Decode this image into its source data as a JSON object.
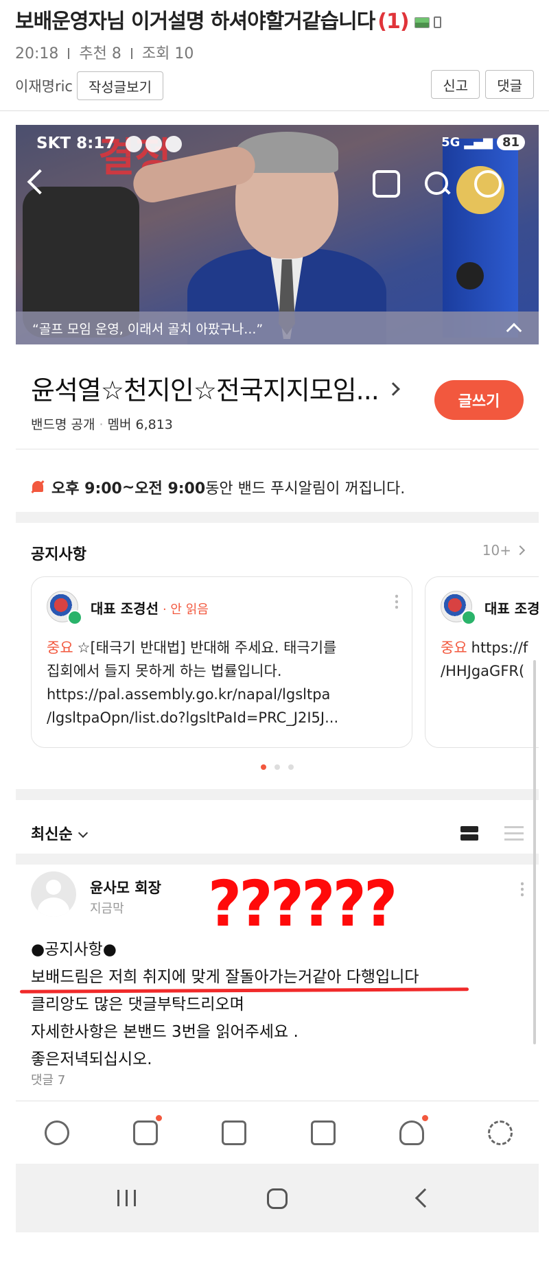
{
  "post": {
    "title": "보배운영자님 이거설명 하셔야할거같습니다",
    "comment_count_badge": "(1)",
    "title_icons": [
      "image-icon",
      "mobile-icon"
    ],
    "time": "20:18",
    "recommend": "추천 8",
    "views": "조회 10",
    "author": "이재명ric",
    "view_posts_button": "작성글보기",
    "report_button": "신고",
    "comment_button": "댓글"
  },
  "phone": {
    "status": {
      "carrier_time": "SKT 8:17",
      "network": "5G",
      "battery": "81"
    },
    "cover": {
      "headline": "결정",
      "notice": "“골프 모임 운영, 이래서 골치 아팠구나...”"
    },
    "band": {
      "name": "윤석열☆천지인☆전국지지모임...",
      "visibility": "밴드명 공개",
      "members": "멤버 6,813",
      "write_button": "글쓰기"
    },
    "push_notice": {
      "start": "오후 9:00",
      "sep": " ~ ",
      "end": "오전 9:00",
      "text": " 동안 밴드 푸시알림이 꺼집니다."
    },
    "notices": {
      "title": "공지사항",
      "more": "10+",
      "cards": [
        {
          "author": "대표 조경선",
          "status": "· 안 읽음",
          "tag": "중요",
          "lines": [
            "☆[태극기 반대법] 반대해 주세요. 태극기를",
            "집회에서 들지 못하게 하는 법률입니다.",
            "https://pal.assembly.go.kr/napal/lgsltpa",
            "/lgsltpaOpn/list.do?lgsltPaId=PRC_J2I5J..."
          ]
        },
        {
          "author": "대표 조경",
          "tag": "중요",
          "lines": [
            "https://f",
            "/HHJgaGFR("
          ]
        }
      ]
    },
    "sort": {
      "label": "최신순"
    },
    "feed": {
      "author": "윤사모 회장",
      "time": "지금막",
      "annotation": "??????",
      "lines": [
        "●공지사항●",
        "보배드림은 저희 취지에 맞게 잘돌아가는거같아 다행입니다",
        "클리앙도 많은 댓글부탁드리오며",
        "자세한사항은 본밴드 3번을 읽어주세요 .",
        "좋은저녁되십시오."
      ],
      "comments": "댓글 7"
    },
    "tabs": [
      {
        "icon": "chat-icon",
        "badge": false
      },
      {
        "icon": "photo-icon",
        "badge": true
      },
      {
        "icon": "calendar-icon",
        "badge": false
      },
      {
        "icon": "folder-check-icon",
        "badge": false
      },
      {
        "icon": "members-icon",
        "badge": true
      },
      {
        "icon": "settings-gear-icon",
        "badge": false
      }
    ]
  },
  "colors": {
    "accent_orange": "#f2583e",
    "badge_red": "#e0343a",
    "annotation_red": "#ff0a0a"
  }
}
